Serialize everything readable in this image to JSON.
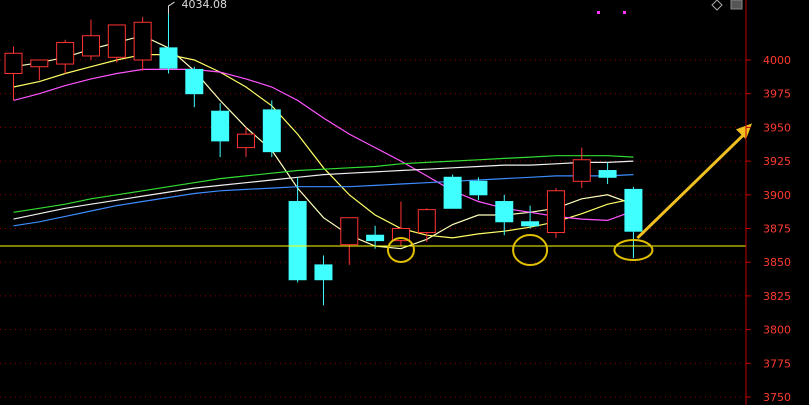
{
  "chart_data": {
    "type": "candlestick",
    "title": "",
    "ylim": [
      3750,
      4060
    ],
    "yticks": [
      3750,
      3775,
      3800,
      3825,
      3850,
      3875,
      3900,
      3925,
      3950,
      3975,
      4000
    ],
    "grid": true,
    "peak_annotation": {
      "text": "4034.08",
      "value": 4034.08,
      "candle_index": 6
    },
    "support_level": 3862,
    "colors": {
      "up": "#ff3333",
      "down": "#40ffff",
      "grid": "#8b0000",
      "axis": "#c00000",
      "support": "#ffff00",
      "circle": "#e0c000",
      "arrow": "#f0c020",
      "ma5": "#ffffbb",
      "ma10": "#ffff66",
      "ma20": "#ff55ff",
      "ma30": "#3c8cff",
      "ma60": "#33dd33",
      "ma_white": "#f0f0f0"
    },
    "candles": [
      {
        "open": 3990,
        "high": 4010,
        "low": 3970,
        "close": 4005
      },
      {
        "open": 3995,
        "high": 4000,
        "low": 3985,
        "close": 4000
      },
      {
        "open": 3997,
        "high": 4015,
        "low": 3990,
        "close": 4013
      },
      {
        "open": 4003,
        "high": 4030,
        "low": 4000,
        "close": 4018
      },
      {
        "open": 4002,
        "high": 4024,
        "low": 3998,
        "close": 4026
      },
      {
        "open": 4000,
        "high": 4032,
        "low": 3992,
        "close": 4028
      },
      {
        "open": 4009,
        "high": 4034.08,
        "low": 3990,
        "close": 3994
      },
      {
        "open": 3993,
        "high": 3995,
        "low": 3965,
        "close": 3975
      },
      {
        "open": 3962,
        "high": 3968,
        "low": 3928,
        "close": 3940
      },
      {
        "open": 3935,
        "high": 3950,
        "low": 3928,
        "close": 3945
      },
      {
        "open": 3963,
        "high": 3970,
        "low": 3928,
        "close": 3932
      },
      {
        "open": 3895,
        "high": 3913,
        "low": 3835,
        "close": 3837
      },
      {
        "open": 3848,
        "high": 3855,
        "low": 3818,
        "close": 3837
      },
      {
        "open": 3863,
        "high": 3880,
        "low": 3848,
        "close": 3883
      },
      {
        "open": 3870,
        "high": 3877,
        "low": 3860,
        "close": 3866
      },
      {
        "open": 3866,
        "high": 3895,
        "low": 3862,
        "close": 3875
      },
      {
        "open": 3872,
        "high": 3890,
        "low": 3865,
        "close": 3889
      },
      {
        "open": 3913,
        "high": 3915,
        "low": 3890,
        "close": 3890
      },
      {
        "open": 3910,
        "high": 3913,
        "low": 3896,
        "close": 3900
      },
      {
        "open": 3895,
        "high": 3900,
        "low": 3870,
        "close": 3880
      },
      {
        "open": 3880,
        "high": 3892,
        "low": 3875,
        "close": 3877
      },
      {
        "open": 3872,
        "high": 3905,
        "low": 3868,
        "close": 3903
      },
      {
        "open": 3910,
        "high": 3935,
        "low": 3905,
        "close": 3926
      },
      {
        "open": 3918,
        "high": 3924,
        "low": 3908,
        "close": 3913
      },
      {
        "open": 3904,
        "high": 3906,
        "low": 3853,
        "close": 3873
      }
    ],
    "series": [
      {
        "key": "ma5",
        "values": [
          3995,
          3998,
          4002,
          4008,
          4013,
          4018,
          4009,
          3992,
          3970,
          3950,
          3933,
          3905,
          3883,
          3870,
          3862,
          3860,
          3867,
          3878,
          3885,
          3885,
          3887,
          3890,
          3897,
          3900,
          3893
        ]
      },
      {
        "key": "ma10",
        "values": [
          3980,
          3984,
          3990,
          3995,
          4000,
          4004,
          4004,
          4000,
          3991,
          3980,
          3966,
          3945,
          3920,
          3900,
          3885,
          3875,
          3870,
          3868,
          3871,
          3873,
          3876,
          3880,
          3886,
          3893,
          3897
        ]
      },
      {
        "key": "ma20",
        "values": [
          3970,
          3975,
          3981,
          3986,
          3990,
          3993,
          3993,
          3993,
          3991,
          3986,
          3980,
          3970,
          3957,
          3945,
          3935,
          3925,
          3914,
          3903,
          3895,
          3890,
          3887,
          3884,
          3882,
          3881,
          3888
        ]
      },
      {
        "key": "ma30",
        "values": [
          3877,
          3880,
          3884,
          3888,
          3892,
          3895,
          3898,
          3901,
          3903,
          3904,
          3905,
          3906,
          3906,
          3906,
          3907,
          3908,
          3909,
          3910,
          3911,
          3912,
          3913,
          3914,
          3914,
          3914,
          3915
        ]
      },
      {
        "key": "ma_white",
        "values": [
          3882,
          3886,
          3890,
          3893,
          3896,
          3899,
          3902,
          3905,
          3907,
          3909,
          3911,
          3913,
          3915,
          3916,
          3917,
          3918,
          3919,
          3920,
          3921,
          3922,
          3922,
          3923,
          3924,
          3924,
          3925
        ]
      },
      {
        "key": "ma60",
        "values": [
          3887,
          3890,
          3893,
          3897,
          3900,
          3903,
          3906,
          3909,
          3912,
          3914,
          3916,
          3918,
          3919,
          3920,
          3921,
          3923,
          3924,
          3925,
          3926,
          3927,
          3928,
          3929,
          3929,
          3929,
          3928
        ]
      }
    ]
  }
}
